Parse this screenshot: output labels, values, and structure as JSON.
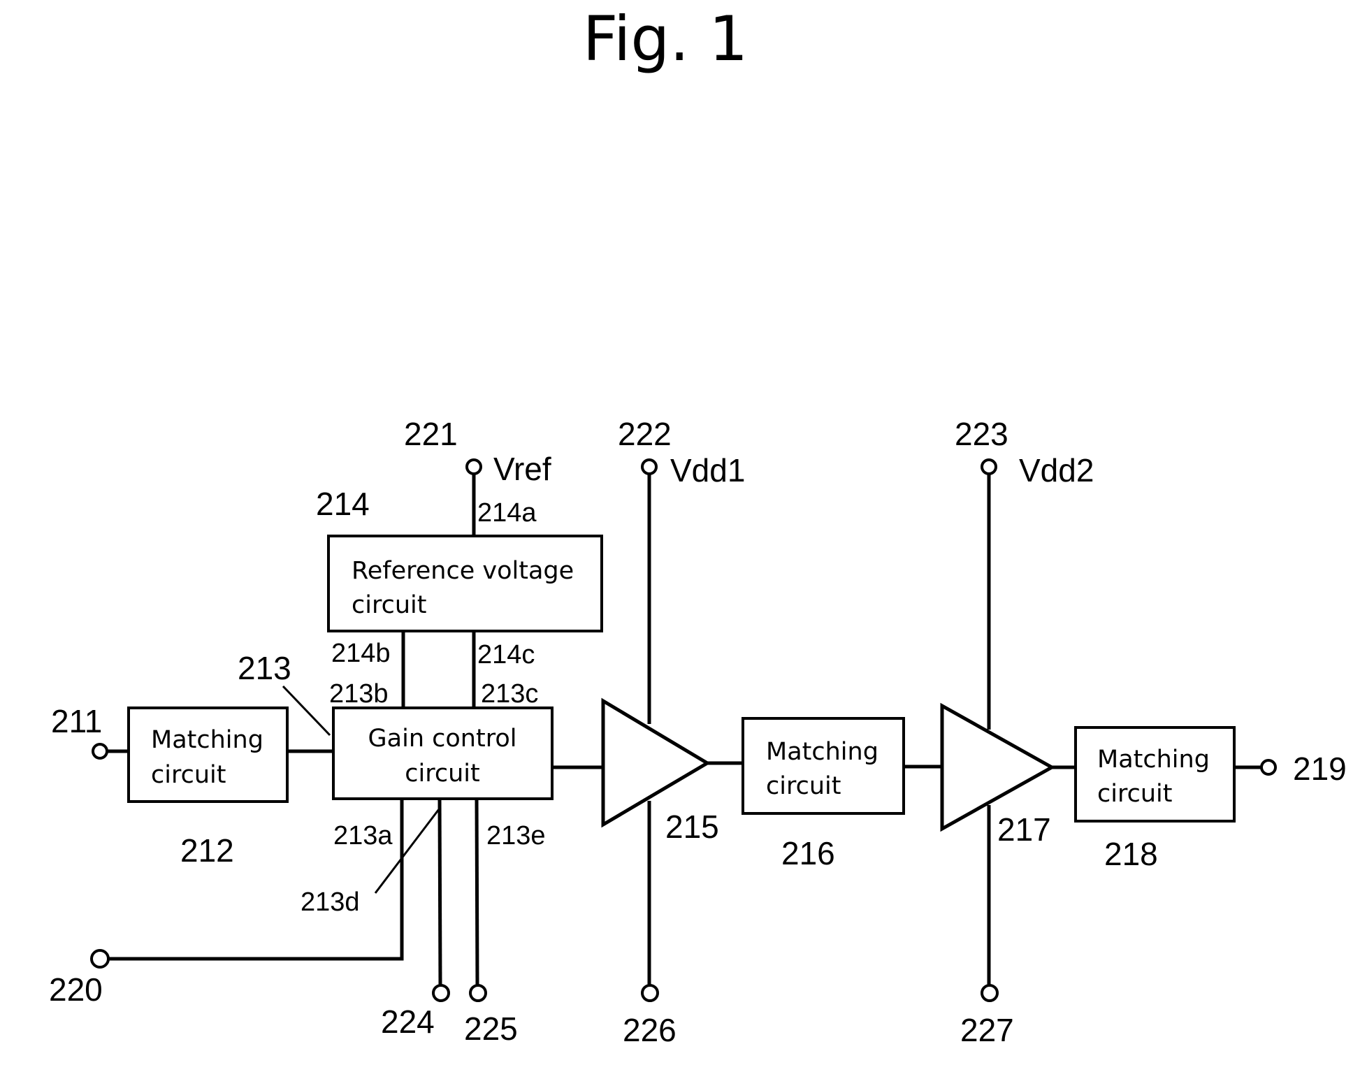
{
  "figure": {
    "title": "Fig. 1",
    "blocks": {
      "matching_212": {
        "ref": "212",
        "line1": "Matching",
        "line2": "circuit"
      },
      "gain_control_213": {
        "ref": "213",
        "line1": "Gain control",
        "line2": "circuit"
      },
      "reference_voltage_214": {
        "ref": "214",
        "line1": "Reference voltage",
        "line2": "circuit"
      },
      "matching_216": {
        "ref": "216",
        "line1": "Matching",
        "line2": "circuit"
      },
      "matching_218": {
        "ref": "218",
        "line1": "Matching",
        "line2": "circuit"
      }
    },
    "amplifiers": {
      "amp_215": {
        "ref": "215"
      },
      "amp_217": {
        "ref": "217"
      }
    },
    "terminals": {
      "t211": {
        "ref": "211"
      },
      "t219": {
        "ref": "219"
      },
      "t220": {
        "ref": "220"
      },
      "t221": {
        "ref": "221",
        "signal": "Vref"
      },
      "t222": {
        "ref": "222",
        "signal": "Vdd1"
      },
      "t223": {
        "ref": "223",
        "signal": "Vdd2"
      },
      "t224": {
        "ref": "224"
      },
      "t225": {
        "ref": "225"
      },
      "t226": {
        "ref": "226"
      },
      "t227": {
        "ref": "227"
      }
    },
    "ports": {
      "p213a": "213a",
      "p213b": "213b",
      "p213c": "213c",
      "p213d": "213d",
      "p213e": "213e",
      "p214a": "214a",
      "p214b": "214b",
      "p214c": "214c"
    }
  }
}
